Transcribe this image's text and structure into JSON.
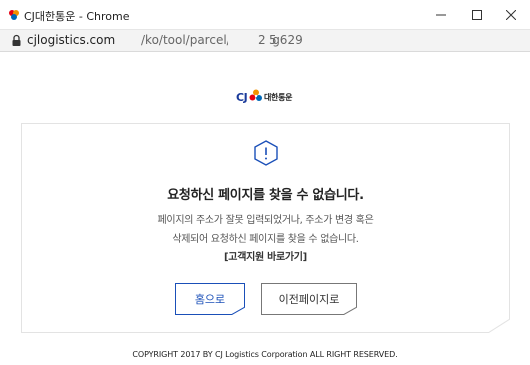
{
  "window": {
    "title": "CJ대한통운 - Chrome",
    "controls": {
      "minimize": "minimize-icon",
      "maximize": "maximize-icon",
      "close": "close-icon"
    }
  },
  "address": {
    "host": "cjlogistics.com",
    "path": "/ko/tool/parcel/tracking629",
    "tail_a": "2",
    "tail_b": "5"
  },
  "logo": {
    "mark": "CJ",
    "text": "대한통운"
  },
  "error": {
    "heading": "요청하신 페이지를 찾을 수 없습니다.",
    "line1": "페이지의 주소가 잘못 입력되었거나, 주소가 변경 혹은",
    "line2": "삭제되어 요청하신 페이지를 찾을 수 없습니다.",
    "support_link": "[고객지원 바로가기]"
  },
  "buttons": {
    "home": "홈으로",
    "previous": "이전페이지로"
  },
  "footer": {
    "copyright": "COPYRIGHT 2017 BY CJ Logistics Corporation ALL RIGHT RESERVED."
  },
  "colors": {
    "accent": "#1a4fb8",
    "brand_orange": "#f39200",
    "brand_red": "#e60012",
    "brand_blue": "#0068b7"
  }
}
